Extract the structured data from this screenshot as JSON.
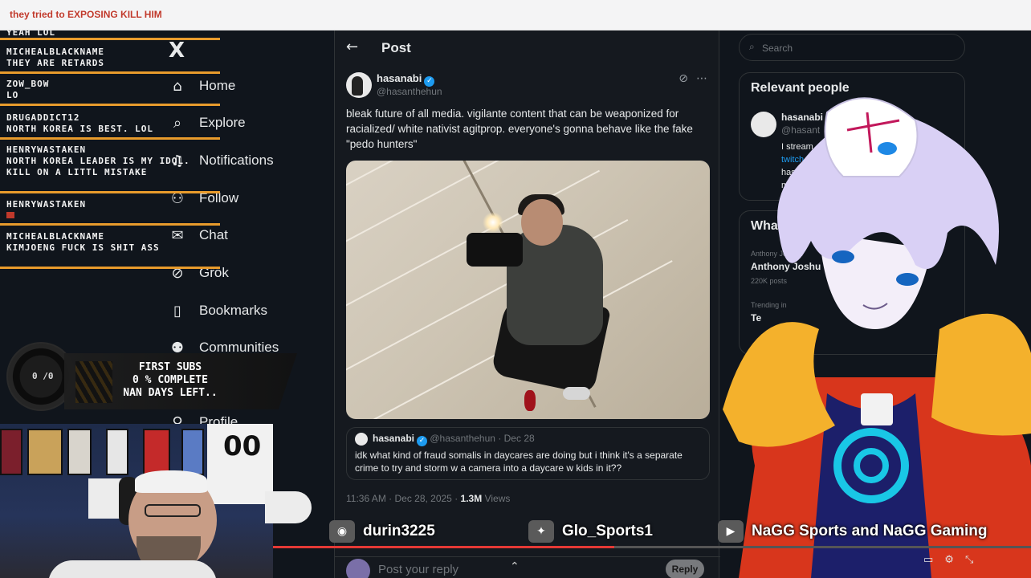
{
  "browser": {
    "tab_title": "they tried to EXPOSING KILL HIM"
  },
  "chat": {
    "messages": [
      {
        "user": "",
        "text": "YEAH LOL"
      },
      {
        "user": "MICHEALBLACKNAME",
        "text": "THEY ARE RETARDS"
      },
      {
        "user": "ZOW_BOW",
        "text": "LO"
      },
      {
        "user": "DRUGADDICT12",
        "text": "NORTH KOREA IS BEST. LOL"
      },
      {
        "user": "HENRYWASTAKEN",
        "text": "NORTH KOREA LEADER IS MY IDOL. KILL ON A LITTL MISTAKE"
      },
      {
        "user": "HENRYWASTAKEN",
        "text": ""
      },
      {
        "user": "MICHEALBLACKNAME",
        "text": "KIMJOENG FUCK IS SHIT ASS"
      }
    ]
  },
  "subs_goal": {
    "counter": "0 /0",
    "lines": [
      "FIRST SUBS",
      "0 % COMPLETE",
      "NAN DAYS LEFT.."
    ]
  },
  "nav": {
    "logo": "X",
    "items": [
      {
        "label": "Home",
        "icon": "home-icon"
      },
      {
        "label": "Explore",
        "icon": "search-icon"
      },
      {
        "label": "Notifications",
        "icon": "bell-icon"
      },
      {
        "label": "Follow",
        "icon": "follow-icon"
      },
      {
        "label": "Chat",
        "icon": "mail-icon"
      },
      {
        "label": "Grok",
        "icon": "grok-icon"
      },
      {
        "label": "Bookmarks",
        "icon": "bookmark-icon"
      },
      {
        "label": "Communities",
        "icon": "people-icon"
      },
      {
        "label": "Profile",
        "icon": "person-icon"
      }
    ]
  },
  "post": {
    "header_title": "Post",
    "author_name": "hasanabi",
    "author_handle": "@hasanthehun",
    "text": "bleak future of all media. vigilante content that can be weaponized for racialized/ white nativist agitprop. everyone's gonna behave like the fake \"pedo hunters\"",
    "quote": {
      "name": "hasanabi",
      "handle": "@hasanthehun",
      "date": "· Dec 28",
      "text": "idk what kind of fraud somalis in daycares are doing but i think it's a separate crime to try and storm w a camera into a daycare w kids in it??"
    },
    "meta_time": "11:36 AM · Dec 28, 2025 ·",
    "meta_views_count": "1.3M",
    "meta_views_label": "Views",
    "reply_placeholder": "Post your reply",
    "reply_button": "Reply"
  },
  "right": {
    "search_placeholder": "Search",
    "relevant_title": "Relevant people",
    "relevant": {
      "name": "hasanabi",
      "handle": "@hasant",
      "bio": [
        "I stream",
        "twitch",
        "hasa",
        "ma"
      ]
    },
    "whats_happening_title": "What's hap",
    "trends": [
      {
        "meta": "Anthony Joshua",
        "topic": "Anthony Joshu",
        "posts": "220K posts"
      },
      {
        "meta": "Trending in",
        "topic": "Te",
        "posts": ""
      }
    ]
  },
  "ticker": {
    "items": [
      {
        "icon": "discord-icon",
        "label": "durin3225",
        "color": "#5865f2"
      },
      {
        "icon": "twitter-bird-icon",
        "label": "Glo_Sports1",
        "color": "#1d9bf0"
      },
      {
        "icon": "youtube-icon",
        "label": "NaGG Sports and NaGG Gaming",
        "color": "#e53935"
      }
    ]
  },
  "player": {
    "progress": 0.45
  },
  "colors": {
    "accent_rule": "#e89b2c",
    "x_blue": "#1d9bf0",
    "bg": "#15191f"
  }
}
